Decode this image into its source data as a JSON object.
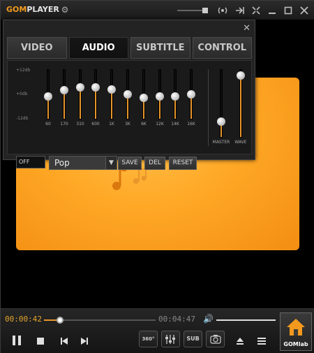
{
  "titlebar": {
    "logo_gom": "GOM",
    "logo_player": "PLAYER",
    "icons": [
      "gear-icon",
      "broadcast-icon",
      "pin-icon",
      "fullscreen-icon",
      "minimize-icon",
      "maximize-icon",
      "close-icon"
    ]
  },
  "equalizer": {
    "tabs": [
      "VIDEO",
      "AUDIO",
      "SUBTITLE",
      "CONTROL"
    ],
    "active_tab": "AUDIO",
    "db_top": "+12db",
    "db_mid": "+0db",
    "db_bottom": "-12db",
    "bands": [
      {
        "label": "60",
        "level": 0.45
      },
      {
        "label": "170",
        "level": 0.6
      },
      {
        "label": "310",
        "level": 0.67
      },
      {
        "label": "600",
        "level": 0.67
      },
      {
        "label": "1K",
        "level": 0.62
      },
      {
        "label": "3K",
        "level": 0.5
      },
      {
        "label": "6K",
        "level": 0.42
      },
      {
        "label": "12K",
        "level": 0.45
      },
      {
        "label": "14K",
        "level": 0.45
      },
      {
        "label": "16K",
        "level": 0.5
      }
    ],
    "master": {
      "label": "MASTER",
      "level": 0.2
    },
    "wave": {
      "label": "WAVE",
      "level": 0.97
    },
    "off_label": "OFF",
    "preset": "Pop",
    "save_label": "SAVE",
    "del_label": "DEL",
    "reset_label": "RESET"
  },
  "playback": {
    "current_time": "00:00:42",
    "total_time": "00:04:47",
    "progress": 0.146,
    "volume": 1.0,
    "btn_360": "360°",
    "btn_sub": "SUB",
    "gomlab_label": "GOMlab"
  },
  "colors": {
    "accent": "#e8952a",
    "video_orange": "#ffa826"
  }
}
